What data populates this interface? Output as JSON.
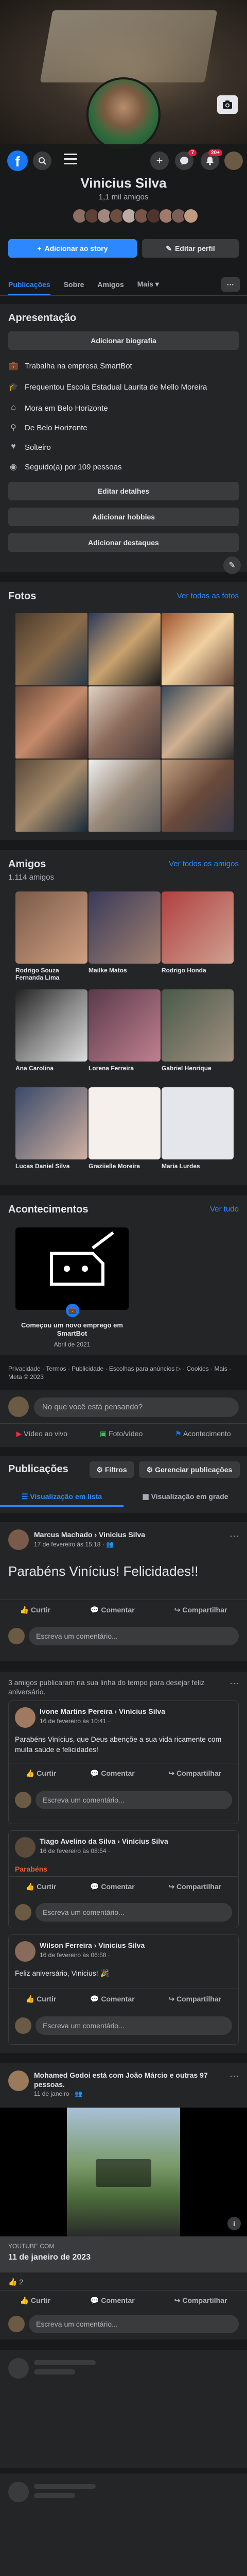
{
  "profile": {
    "name": "Vinicius Silva",
    "friends_count": "1,1 mil amigos"
  },
  "header": {
    "notif_badge_messages": "7",
    "notif_badge_bell": "20+"
  },
  "actions": {
    "add_story": "Adicionar ao story",
    "edit_profile": "Editar perfil"
  },
  "tabs": [
    "Publicações",
    "Sobre",
    "Amigos",
    "Mais"
  ],
  "intro": {
    "title": "Apresentação",
    "add_bio": "Adicionar biografia",
    "items": [
      {
        "icon": "briefcase-icon",
        "text": "Trabalha na empresa SmartBot"
      },
      {
        "icon": "graduation-icon",
        "text": "Frequentou Escola Estadual Laurita de Mello Moreira"
      },
      {
        "icon": "home-icon",
        "text": "Mora em Belo Horizonte"
      },
      {
        "icon": "location-icon",
        "text": "De Belo Horizonte"
      },
      {
        "icon": "heart-icon",
        "text": "Solteiro"
      },
      {
        "icon": "rss-icon",
        "text": "Seguido(a) por 109 pessoas"
      }
    ],
    "edit_details": "Editar detalhes",
    "add_hobbies": "Adicionar hobbies",
    "add_highlights": "Adicionar destaques"
  },
  "photos": {
    "title": "Fotos",
    "see_all": "Ver todas as fotos"
  },
  "friends": {
    "title": "Amigos",
    "count": "1.114 amigos",
    "see_all": "Ver todos os amigos",
    "list": [
      "Rodrigo Souza Fernanda Lima",
      "Mailke Matos",
      "Rodrigo Honda",
      "Ana Carolina",
      "Lorena Ferreira",
      "Gabriel Henrique",
      "Lucas Daniel Silva",
      "Graziielle Moreira",
      "Maria Lurdes"
    ]
  },
  "events": {
    "title": "Acontecimentos",
    "see_all": "Ver tudo",
    "item_title": "Começou um novo emprego em SmartBot",
    "item_date": "Abril de 2021"
  },
  "footer_links": "Privacidade · Termos · Publicidade · Escolhas para anúncios ▷ · Cookies · Mais · Meta © 2023",
  "composer": {
    "placeholder": "No que você está pensando?",
    "live": "Vídeo ao vivo",
    "photo": "Foto/vídeo",
    "event": "Acontecimento"
  },
  "posts_header": {
    "title": "Publicações",
    "filters": "Filtros",
    "manage": "Gerenciar publicações",
    "list_view": "Visualização em lista",
    "grid_view": "Visualização em grade"
  },
  "post1": {
    "author": "Marcus Machado › Vinicius Silva",
    "date": "17 de fevereiro às 15:18 · ",
    "text": "Parabéns Vinícius! Felicidades!!"
  },
  "post_buttons": {
    "like": "Curtir",
    "comment": "Comentar",
    "share": "Compartilhar",
    "write_comment": "Escreva um comentário..."
  },
  "birthday_group": {
    "intro": "3 amigos publicaram na sua linha do tempo para desejar feliz aniversário.",
    "subposts": [
      {
        "author": "Ivone Martins Pereira › Vinícius Silva",
        "date": "16 de fevereiro às 10:41 · ",
        "text": "Parabéns Vinícius, que Deus abençõe a sua vida ricamente com muita saúde e felicidades!"
      },
      {
        "author": "Tiago Avelino da Silva › Vinícius Silva",
        "date": "16 de fevereiro às 08:54 · ",
        "text": "Parabéns"
      },
      {
        "author": "Wilson Ferreira › Vinicius Silva",
        "date": "16 de fevereiro às 06:58 · ",
        "text": "Feliz aniversário, Vinicius! 🎉"
      }
    ]
  },
  "post_share": {
    "author": "Mohamed Godoi está com João Márcio e outras 97 pessoas.",
    "date": "11 de janeiro · ",
    "source": "YOUTUBE.COM",
    "title": "11 de janeiro de 2023",
    "reactions": "2"
  }
}
